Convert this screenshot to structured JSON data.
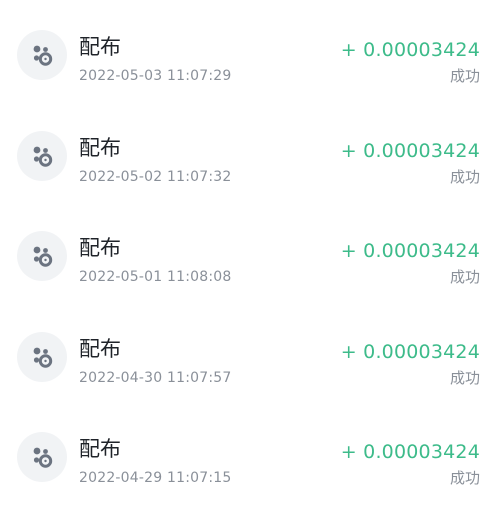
{
  "colors": {
    "amount": "#3dbb8a",
    "title": "#1f2329",
    "secondary": "#8a9099",
    "avatar_bg": "#f1f3f5",
    "icon": "#6b7380"
  },
  "transactions": [
    {
      "icon": "coins-icon",
      "title": "配布",
      "time": "2022-05-03 11:07:29",
      "amount": "+ 0.00003424",
      "status": "成功"
    },
    {
      "icon": "coins-icon",
      "title": "配布",
      "time": "2022-05-02 11:07:32",
      "amount": "+ 0.00003424",
      "status": "成功"
    },
    {
      "icon": "coins-icon",
      "title": "配布",
      "time": "2022-05-01 11:08:08",
      "amount": "+ 0.00003424",
      "status": "成功"
    },
    {
      "icon": "coins-icon",
      "title": "配布",
      "time": "2022-04-30 11:07:57",
      "amount": "+ 0.00003424",
      "status": "成功"
    },
    {
      "icon": "coins-icon",
      "title": "配布",
      "time": "2022-04-29 11:07:15",
      "amount": "+ 0.00003424",
      "status": "成功"
    }
  ]
}
